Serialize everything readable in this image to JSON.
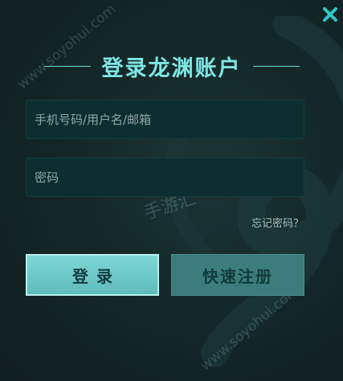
{
  "dialog": {
    "title": "登录龙渊账户",
    "close_icon": "close-icon",
    "accent_color": "#7fe6e4",
    "close_color": "#2ec8c8"
  },
  "form": {
    "account_placeholder": "手机号码/用户名/邮箱",
    "password_placeholder": "密码",
    "forgot_password": "忘记密码？",
    "login_label": "登录",
    "register_label": "快速注册"
  },
  "watermarks": {
    "site_top": "www.soyohui.com",
    "site_bottom": "www.soyohui.com",
    "brand": "手游汇"
  }
}
